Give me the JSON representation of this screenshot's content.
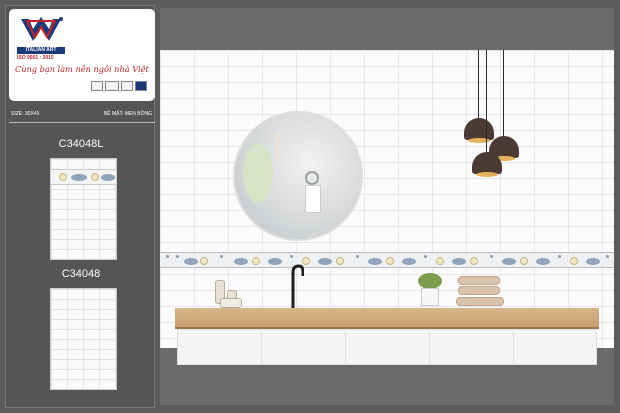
{
  "brand": {
    "logo_name": "italian-art-logo",
    "name": "ITALIAN ART",
    "iso": "ISO 9001 : 2015",
    "slogan": "Cùng bạn làm nên ngôi nhà Việt",
    "colors": {
      "primary": "#1b3a7a",
      "accent": "#c0242b"
    }
  },
  "specs": {
    "size": "SIZE: 30X45",
    "surface": "BỀ MẶT: MEN BÓNG"
  },
  "products": [
    {
      "code": "C34048L"
    },
    {
      "code": "C34048"
    }
  ],
  "scene": {
    "description_icon": "bathroom-scene-image"
  }
}
